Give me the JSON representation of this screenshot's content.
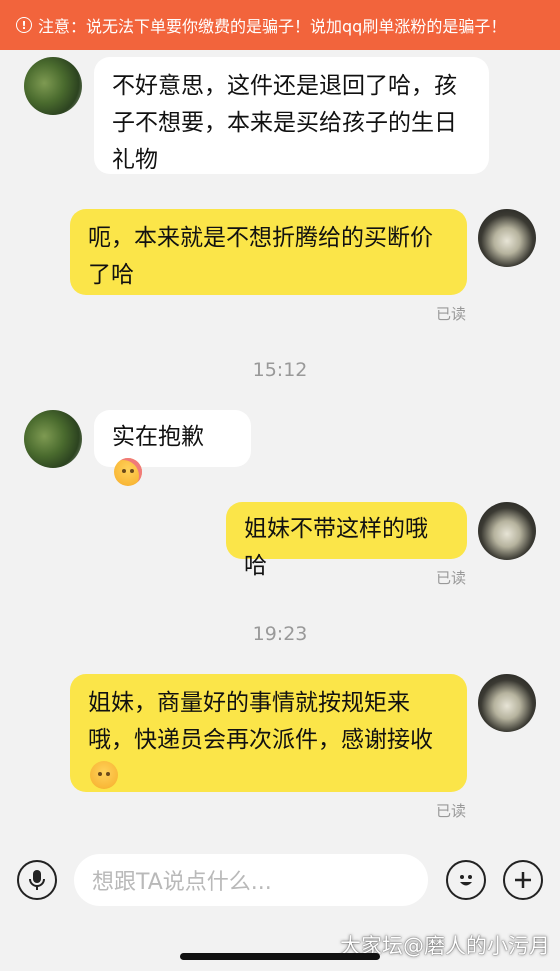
{
  "banner": {
    "icon": "info-circle-icon",
    "text": "注意：说无法下单要你缴费的是骗子！说加qq刷单涨粉的是骗子！"
  },
  "messages": [
    {
      "side": "in",
      "text": "不好意思，这件还是退回了哈，孩子不想要，本来是买给孩子的生日礼物"
    },
    {
      "side": "out",
      "text": "呃，本来就是不想折腾给的买断价了哈",
      "status": "已读"
    },
    {
      "timestamp": "15:12"
    },
    {
      "side": "in",
      "text": "实在抱歉",
      "emoji": "shy-face-emoji"
    },
    {
      "side": "out",
      "text": "姐妹不带这样的哦哈",
      "status": "已读"
    },
    {
      "timestamp": "19:23"
    },
    {
      "side": "out",
      "text": "姐妹，商量好的事情就按规矩来哦，快递员会再次派件，感谢接收",
      "emoji": "smile-face-emoji",
      "status": "已读"
    }
  ],
  "composer": {
    "voice_icon": "microphone-icon",
    "placeholder": "想跟TA说点什么...",
    "emoji_icon": "smiley-icon",
    "plus_icon": "plus-icon"
  },
  "watermark": "大家坛@磨人的小污月",
  "colors": {
    "banner": "#f2643c",
    "outgoing_bubble": "#fbe549",
    "incoming_bubble": "#ffffff",
    "background": "#f2f2f2"
  }
}
